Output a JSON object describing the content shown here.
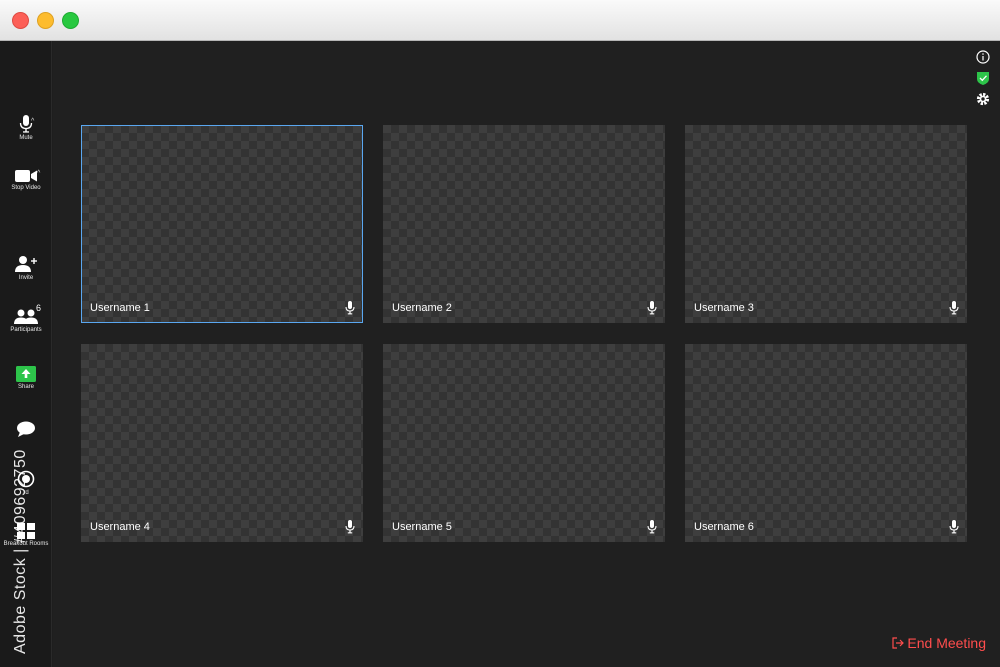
{
  "window": {
    "controls": [
      "close",
      "minimize",
      "maximize"
    ]
  },
  "sidebar": {
    "mute_label": "Mute",
    "video_label": "Stop Video",
    "invite_label": "Invite",
    "participants_label": "Participants",
    "participants_count": "6",
    "share_label": "Share",
    "chat_label": "",
    "record_label": "rd",
    "breakout_label": "Breakout Rooms"
  },
  "tiles": [
    {
      "name": "Username 1",
      "active": true
    },
    {
      "name": "Username 2",
      "active": false
    },
    {
      "name": "Username 3",
      "active": false
    },
    {
      "name": "Username 4",
      "active": false
    },
    {
      "name": "Username 5",
      "active": false
    },
    {
      "name": "Username 6",
      "active": false
    }
  ],
  "top_icons": [
    "info-icon",
    "shield-check-icon",
    "gear-icon"
  ],
  "end_meeting_label": "End Meeting",
  "watermark": "Adobe Stock | #409692750",
  "colors": {
    "accent_border": "#5aa7f0",
    "end_meeting": "#ff4d4d",
    "share_green": "#2dc44a",
    "shield_green": "#2dc44a"
  }
}
